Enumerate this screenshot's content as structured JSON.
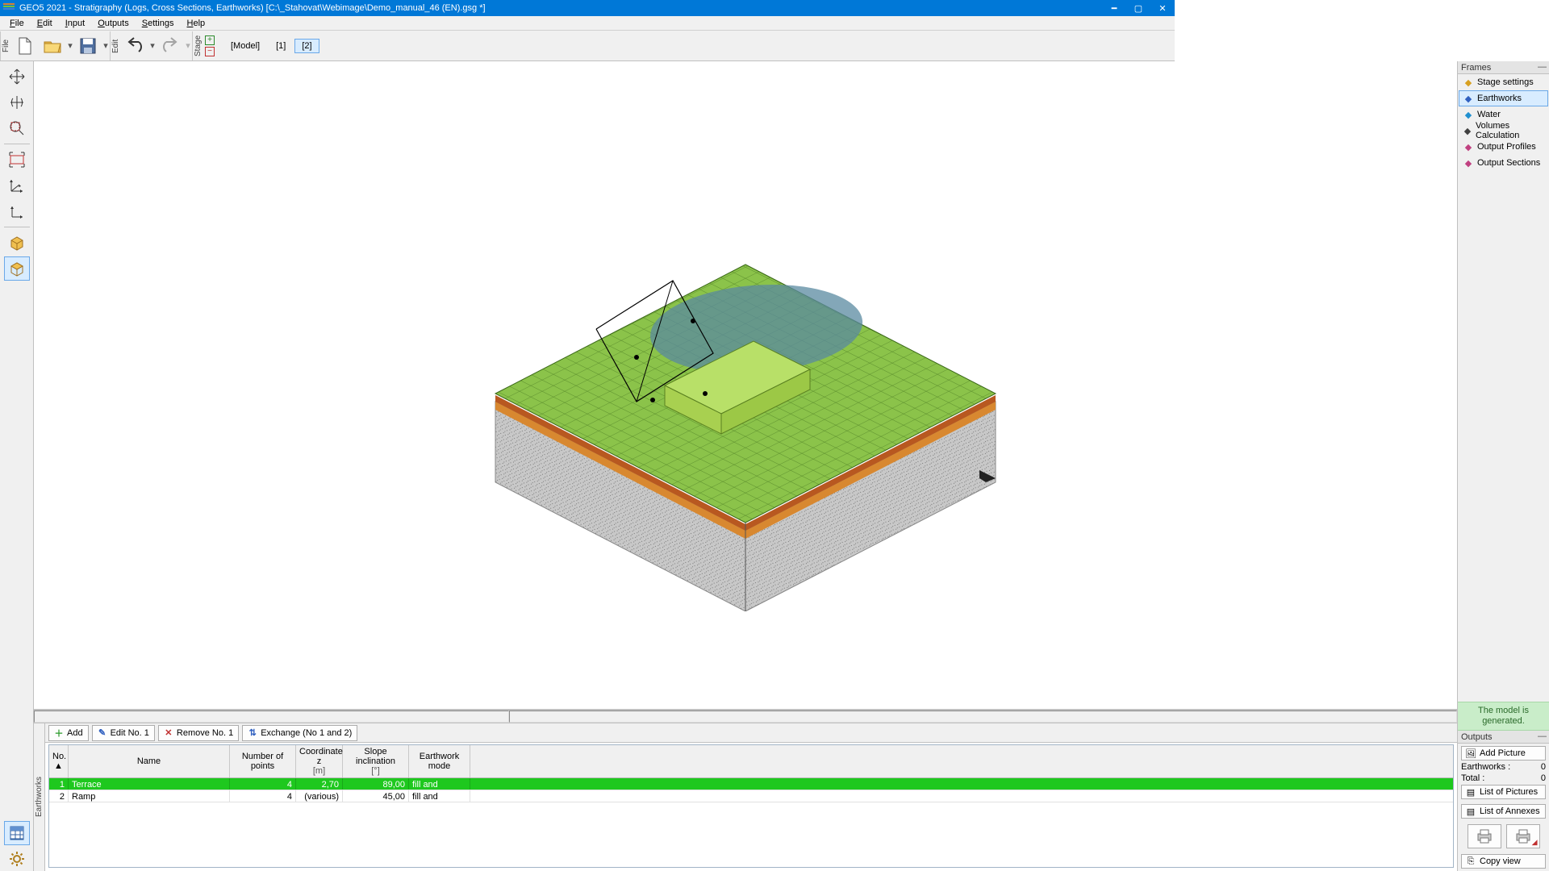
{
  "title": "GEO5 2021 - Stratigraphy (Logs, Cross Sections, Earthworks) [C:\\_Stahovat\\Webimage\\Demo_manual_46 (EN).gsg *]",
  "menu": {
    "file": "File",
    "edit": "Edit",
    "input": "Input",
    "outputs": "Outputs",
    "settings": "Settings",
    "help": "Help"
  },
  "toolbar": {
    "file_label": "File",
    "edit_label": "Edit",
    "stage_label": "Stage",
    "stages": [
      "[Model]",
      "[1]",
      "[2]"
    ],
    "active_stage": 2
  },
  "frames": {
    "header": "Frames",
    "items": [
      {
        "label": "Stage settings",
        "icon": "stage-settings-icon",
        "color": "#d8a020"
      },
      {
        "label": "Earthworks",
        "icon": "earthworks-icon",
        "color": "#3060c0",
        "selected": true
      },
      {
        "label": "Water",
        "icon": "water-icon",
        "color": "#2090d0"
      },
      {
        "label": "Volumes Calculation",
        "icon": "volumes-icon",
        "color": "#404040"
      },
      {
        "label": "Output Profiles",
        "icon": "profiles-icon",
        "color": "#c04080"
      },
      {
        "label": "Output Sections",
        "icon": "sections-icon",
        "color": "#c04080"
      }
    ]
  },
  "status": {
    "line1": "The model is",
    "line2": "generated."
  },
  "outputs": {
    "header": "Outputs",
    "add_picture": "Add Picture",
    "earthworks_label": "Earthworks :",
    "earthworks_val": "0",
    "total_label": "Total :",
    "total_val": "0",
    "list_pictures": "List of Pictures",
    "list_annexes": "List of Annexes",
    "copy_view": "Copy view"
  },
  "bottom": {
    "tab": "Earthworks",
    "add": "Add",
    "edit": "Edit No. 1",
    "remove": "Remove No. 1",
    "exchange": "Exchange (No 1 and 2)",
    "cols": {
      "no": "No.",
      "name": "Name",
      "np": "Number of points",
      "cz": "Coordinate z",
      "cz_unit": "[m]",
      "si": "Slope inclination",
      "si_unit": "[°]",
      "em": "Earthwork mode"
    },
    "rows": [
      {
        "no": "1",
        "name": "Terrace",
        "np": "4",
        "cz": "2,70",
        "si": "89,00",
        "em": "fill and excavate",
        "selected": true
      },
      {
        "no": "2",
        "name": "Ramp",
        "np": "4",
        "cz": "(various)",
        "si": "45,00",
        "em": "fill and excavate"
      }
    ]
  }
}
